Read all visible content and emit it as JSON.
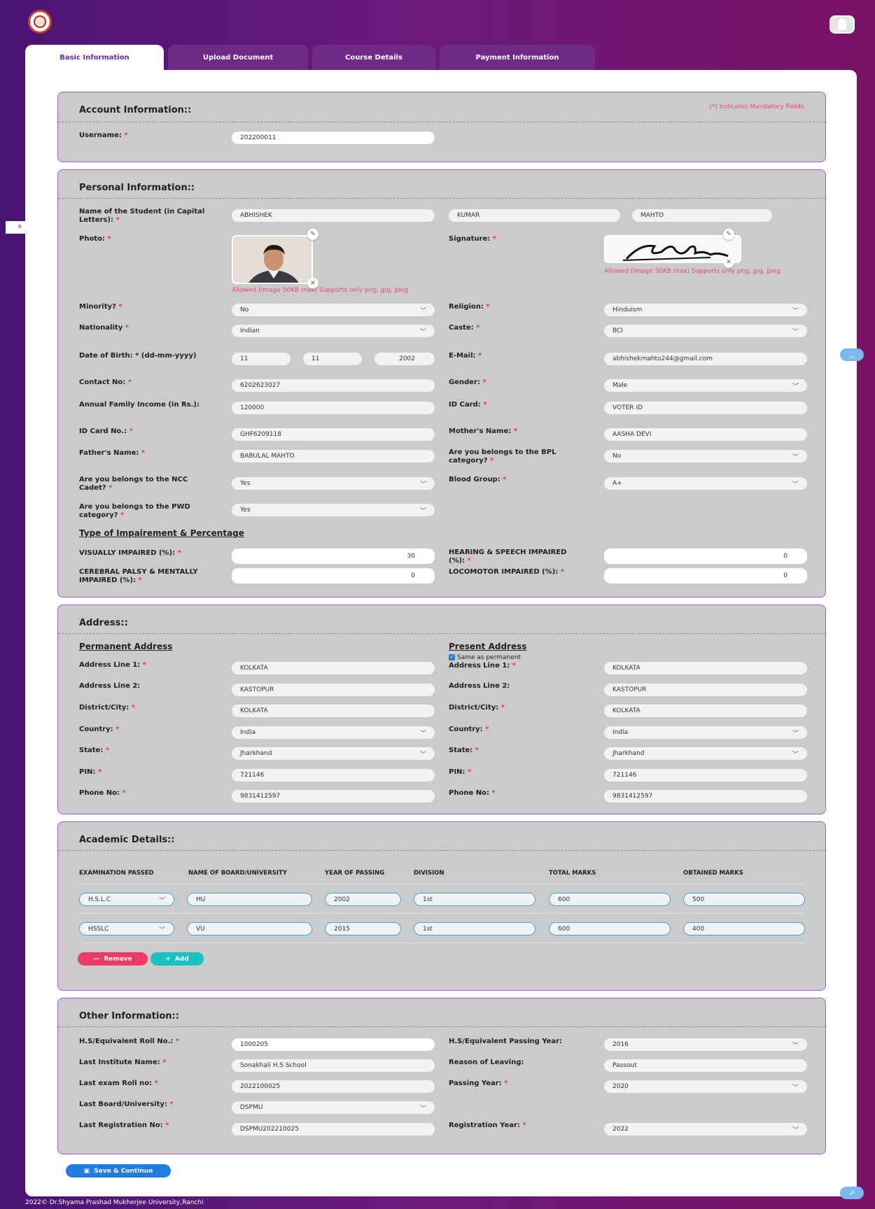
{
  "header": {
    "tabs": [
      {
        "label": "Basic Information",
        "active": true
      },
      {
        "label": "Upload Document",
        "active": false
      },
      {
        "label": "Course Details",
        "active": false
      },
      {
        "label": "Payment Information",
        "active": false
      }
    ],
    "logo_icon": "university-seal-icon",
    "avatar_icon": "user-icon"
  },
  "colors": {
    "accent": "#6b27b8",
    "required": "#e53c3c",
    "remove": "#ef3a66",
    "add": "#19c0c4",
    "save": "#1e7de0"
  },
  "account": {
    "title": "Account Information::",
    "mandatory_note": "(*) Indicates Mandatory Fields.",
    "username_label": "Username:",
    "username": "202200011"
  },
  "personal": {
    "title": "Personal Information::",
    "name_label": "Name of the Student (in Capital Letters):",
    "first_name": "ABHISHEK",
    "middle_name": "KUMAR",
    "last_name": "MAHTO",
    "photo_label": "Photo:",
    "photo_note": "Allowed (image 50KB max) Supports only png, jpg, jpeg",
    "signature_label": "Signature:",
    "signature_note": "Allowed (image 30KB max) Supports only png, jpg, jpeg",
    "minority_label": "Minority?",
    "minority": "No",
    "religion_label": "Religion:",
    "religion": "Hinduism",
    "nationality_label": "Nationality",
    "nationality": "Indian",
    "caste_label": "Caste:",
    "caste": "BCI",
    "dob_label": "Date of Birth: * (dd-mm-yyyy)",
    "dob_day": "11",
    "dob_month": "11",
    "dob_year": "2002",
    "email_label": "E-Mail:",
    "email": "abhishekmahto244@gmail.com",
    "contact_label": "Contact No:",
    "contact": "6202623027",
    "gender_label": "Gender:",
    "gender": "Male",
    "income_label": "Annual Family Income (in Rs.):",
    "income": "120000",
    "idcard_label": "ID Card:",
    "idcard": "VOTER ID",
    "idcard_no_label": "ID Card No.:",
    "idcard_no": "GHF6209118",
    "mother_label": "Mother's Name:",
    "mother": "AASHA DEVI",
    "father_label": "Father's Name:",
    "father": "BABULAL MAHTO",
    "bpl_label": "Are you belongs to the BPL category?",
    "bpl": "No",
    "ncc_label": "Are you belongs to the NCC Cadet?",
    "ncc": "Yes",
    "blood_label": "Blood Group:",
    "blood": "A+",
    "pwd_label": "Are you belongs to the PWD category?",
    "pwd": "Yes",
    "impairment_title": "Type of Impairement & Percentage",
    "visual_label": "VISUALLY IMPAIRED (%):",
    "visual": "30",
    "hearing_label": "HEARING & SPEECH IMPAIRED (%):",
    "hearing": "0",
    "cerebral_label": "CEREBRAL PALSY & MENTALLY IMPAIRED (%):",
    "cerebral": "0",
    "locomotor_label": "LOCOMOTOR IMPAIRED (%):",
    "locomotor": "0"
  },
  "address": {
    "title": "Address::",
    "permanent_title": "Permanent Address",
    "present_title": "Present Address",
    "same_label": "Same as permanent",
    "same_checked": true,
    "line1_label": "Address Line 1:",
    "line2_label": "Address Line 2:",
    "district_label": "District/City:",
    "country_label": "Country:",
    "state_label": "State:",
    "pin_label": "PIN:",
    "phone_label": "Phone No:",
    "permanent": {
      "line1": "KOLKATA",
      "line2": "KASTOPUR",
      "district": "KOLKATA",
      "country": "India",
      "state": "Jharkhand",
      "pin": "721146",
      "phone": "9831412597"
    },
    "present": {
      "line1": "KOLKATA",
      "line2": "KASTOPUR",
      "district": "KOLKATA",
      "country": "India",
      "state": "Jharkhand",
      "pin": "721146",
      "phone": "9831412597"
    }
  },
  "academic": {
    "title": "Academic Details::",
    "columns": [
      "EXAMINATION PASSED",
      "NAME OF BOARD/UNIVERSITY",
      "YEAR OF PASSING",
      "DIVISION",
      "TOTAL MARKS",
      "OBTAINED MARKS"
    ],
    "rows": [
      {
        "exam": "H.S.L.C",
        "board": "HU",
        "year": "2002",
        "division": "1st",
        "total": "600",
        "obtained": "500"
      },
      {
        "exam": "HSSLC",
        "board": "VU",
        "year": "2015",
        "division": "1st",
        "total": "600",
        "obtained": "400"
      }
    ],
    "remove_label": "Remove",
    "add_label": "Add"
  },
  "other": {
    "title": "Other Information::",
    "roll_label": "H.S/Equivalent Roll No.:",
    "roll": "1000205",
    "hs_year_label": "H.S/Equivalent Passing Year:",
    "hs_year": "2016",
    "institute_label": "Last Institute Name:",
    "institute": "Sonakhali H.S School",
    "reason_label": "Reason of Leaving:",
    "reason": "Passout",
    "exam_roll_label": "Last exam Roll no:",
    "exam_roll": "2022100025",
    "passing_year_label": "Passing Year:",
    "passing_year": "2020",
    "board_label": "Last Board/University:",
    "board": "DSPMU",
    "reg_no_label": "Last Registration No:",
    "reg_no": "DSPMU202210025",
    "reg_year_label": "Registration Year:",
    "reg_year": "2022"
  },
  "save_label": "Save & Continue",
  "footer": "2022© Dr.Shyama Prashad Mukherjee University,Ranchi"
}
